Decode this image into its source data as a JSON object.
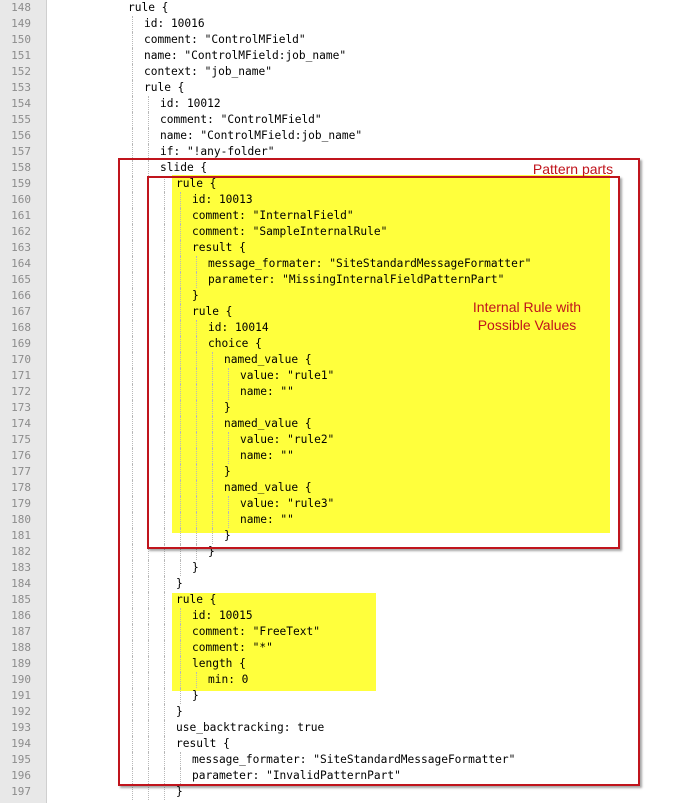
{
  "lines": [
    {
      "n": "148",
      "text": "rule {",
      "ind": 0
    },
    {
      "n": "149",
      "text": "id: 10016",
      "ind": 1
    },
    {
      "n": "150",
      "text": "comment: \"ControlMField\"",
      "ind": 1
    },
    {
      "n": "151",
      "text": "name: \"ControlMField:job_name\"",
      "ind": 1
    },
    {
      "n": "152",
      "text": "context: \"job_name\"",
      "ind": 1
    },
    {
      "n": "153",
      "text": "rule {",
      "ind": 1
    },
    {
      "n": "154",
      "text": "id: 10012",
      "ind": 2
    },
    {
      "n": "155",
      "text": "comment: \"ControlMField\"",
      "ind": 2
    },
    {
      "n": "156",
      "text": "name: \"ControlMField:job_name\"",
      "ind": 2
    },
    {
      "n": "157",
      "text": "if: \"!any-folder\"",
      "ind": 2
    },
    {
      "n": "158",
      "text": "slide {",
      "ind": 2
    },
    {
      "n": "159",
      "text": "rule {",
      "ind": 3
    },
    {
      "n": "160",
      "text": "id: 10013",
      "ind": 4
    },
    {
      "n": "161",
      "text": "comment: \"InternalField\"",
      "ind": 4
    },
    {
      "n": "162",
      "text": "comment: \"SampleInternalRule\"",
      "ind": 4
    },
    {
      "n": "163",
      "text": "result {",
      "ind": 4
    },
    {
      "n": "164",
      "text": "message_formater: \"SiteStandardMessageFormatter\"",
      "ind": 5
    },
    {
      "n": "165",
      "text": "parameter: \"MissingInternalFieldPatternPart\"",
      "ind": 5
    },
    {
      "n": "166",
      "text": "}",
      "ind": 4
    },
    {
      "n": "167",
      "text": "rule {",
      "ind": 4
    },
    {
      "n": "168",
      "text": "id: 10014",
      "ind": 5
    },
    {
      "n": "169",
      "text": "choice {",
      "ind": 5
    },
    {
      "n": "170",
      "text": "named_value {",
      "ind": 6
    },
    {
      "n": "171",
      "text": "value: \"rule1\"",
      "ind": 7
    },
    {
      "n": "172",
      "text": "name: \"\"",
      "ind": 7
    },
    {
      "n": "173",
      "text": "}",
      "ind": 6
    },
    {
      "n": "174",
      "text": "named_value {",
      "ind": 6
    },
    {
      "n": "175",
      "text": "value: \"rule2\"",
      "ind": 7
    },
    {
      "n": "176",
      "text": "name: \"\"",
      "ind": 7
    },
    {
      "n": "177",
      "text": "}",
      "ind": 6
    },
    {
      "n": "178",
      "text": "named_value {",
      "ind": 6
    },
    {
      "n": "179",
      "text": "value: \"rule3\"",
      "ind": 7
    },
    {
      "n": "180",
      "text": "name: \"\"",
      "ind": 7
    },
    {
      "n": "181",
      "text": "}",
      "ind": 6
    },
    {
      "n": "182",
      "text": "}",
      "ind": 5
    },
    {
      "n": "183",
      "text": "}",
      "ind": 4
    },
    {
      "n": "184",
      "text": "}",
      "ind": 3
    },
    {
      "n": "185",
      "text": "rule {",
      "ind": 3
    },
    {
      "n": "186",
      "text": "id: 10015",
      "ind": 4
    },
    {
      "n": "187",
      "text": "comment: \"FreeText\"",
      "ind": 4
    },
    {
      "n": "188",
      "text": "comment: \"*\"",
      "ind": 4
    },
    {
      "n": "189",
      "text": "length {",
      "ind": 4
    },
    {
      "n": "190",
      "text": "min: 0",
      "ind": 5
    },
    {
      "n": "191",
      "text": "}",
      "ind": 4
    },
    {
      "n": "192",
      "text": "}",
      "ind": 3
    },
    {
      "n": "193",
      "text": "use_backtracking: true",
      "ind": 3
    },
    {
      "n": "194",
      "text": "result {",
      "ind": 3
    },
    {
      "n": "195",
      "text": "message_formater: \"SiteStandardMessageFormatter\"",
      "ind": 4
    },
    {
      "n": "196",
      "text": "parameter: \"InvalidPatternPart\"",
      "ind": 4
    },
    {
      "n": "197",
      "text": "}",
      "ind": 3
    }
  ],
  "annotations": {
    "pattern_parts": "Pattern parts",
    "internal_rule_line1": "Internal Rule with",
    "internal_rule_line2": "Possible Values"
  },
  "colors": {
    "highlight": "#ffff3c",
    "annotation_red": "#c0141c",
    "gutter": "#e8e8e8"
  }
}
